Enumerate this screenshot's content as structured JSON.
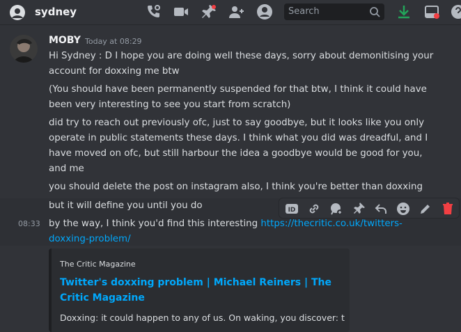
{
  "header": {
    "channel_name": "sydney",
    "search_placeholder": "Search",
    "icons": [
      "threads-icon",
      "video-call-icon",
      "pin-icon",
      "add-member-icon",
      "user-profile-icon",
      "search-icon",
      "download-icon",
      "inbox-icon",
      "help-icon"
    ]
  },
  "message": {
    "author": "MOBY",
    "timestamp": "Today at 08:29",
    "lines": [
      "Hi Sydney : D I hope you are doing well these days, sorry about demonitising your account for doxxing me btw",
      "(You should have been permanently suspended for that btw, I think it could have been very interesting to see you start from scratch)",
      "did try to reach out previously ofc, just to say goodbye, but it looks like you only operate in public statements these days. I think what you did was dreadful, and I have moved on ofc, but still harbour the idea a goodbye would be good for you, and me",
      "you should delete the post on instagram also, I think you're better than doxxing",
      "but it will define you until you do"
    ],
    "hover_time": "08:33",
    "last_text": "by the way, I think you'd find this interesting ",
    "last_link": "https://thecritic.co.uk/twitters-doxxing-problem/"
  },
  "embed": {
    "provider": "The Critic Magazine",
    "title": "Twitter's doxxing problem | Michael Reiners | The Critic Magazine",
    "description": "Doxxing: it could happen to any of us. On waking, you discover: that"
  },
  "actions": [
    "id-icon",
    "link-icon",
    "reply-thread-icon",
    "pin-icon",
    "reply-icon",
    "emoji-icon",
    "edit-icon",
    "delete-icon"
  ],
  "colors": {
    "background": "#313338",
    "link": "#00a8fc",
    "delete": "#f23f43",
    "download": "#23a55a"
  }
}
